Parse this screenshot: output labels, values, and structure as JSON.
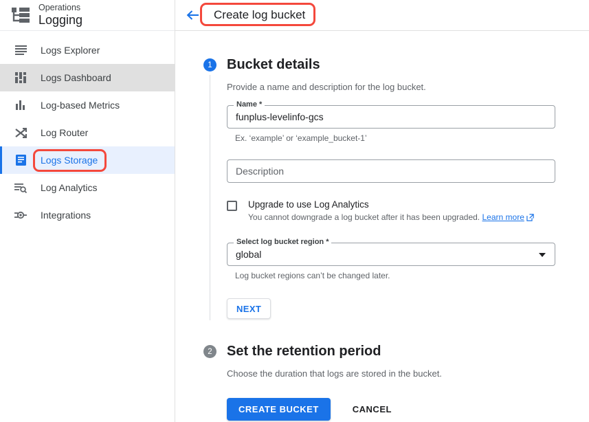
{
  "sidebar": {
    "brand": {
      "subtitle": "Operations",
      "title": "Logging",
      "logo_icon": "logging-hierarchy-icon"
    },
    "items": [
      {
        "label": "Logs Explorer",
        "icon": "list-lines-icon",
        "state": "default"
      },
      {
        "label": "Logs Dashboard",
        "icon": "dashboard-blocks-icon",
        "state": "hovered"
      },
      {
        "label": "Log-based Metrics",
        "icon": "bar-chart-icon",
        "state": "default"
      },
      {
        "label": "Log Router",
        "icon": "shuffle-arrows-icon",
        "state": "default"
      },
      {
        "label": "Logs Storage",
        "icon": "document-lines-icon",
        "state": "active"
      },
      {
        "label": "Log Analytics",
        "icon": "list-search-icon",
        "state": "default"
      },
      {
        "label": "Integrations",
        "icon": "integration-node-icon",
        "state": "default"
      }
    ]
  },
  "topbar": {
    "back_icon": "back-arrow-icon",
    "title": "Create log bucket"
  },
  "steps": [
    {
      "number": "1",
      "heading": "Bucket details",
      "description": "Provide a name and description for the log bucket."
    },
    {
      "number": "2",
      "heading": "Set the retention period",
      "description": "Choose the duration that logs are stored in the bucket."
    }
  ],
  "form": {
    "name_field": {
      "label": "Name *",
      "value": "funplus-levelinfo-gcs",
      "hint": "Ex. ‘example’ or ‘example_bucket-1’"
    },
    "description_field": {
      "placeholder": "Description"
    },
    "upgrade_checkbox": {
      "checked": false,
      "label": "Upgrade to use Log Analytics",
      "sub_text": "You cannot downgrade a log bucket after it has been upgraded.",
      "link_label": "Learn more",
      "link_icon": "external-link-icon"
    },
    "region_select": {
      "label": "Select log bucket region *",
      "value": "global",
      "hint": "Log bucket regions can’t be changed later.",
      "arrow_icon": "chevron-down-icon"
    },
    "next_button": "NEXT"
  },
  "actions": {
    "create_label": "CREATE BUCKET",
    "cancel_label": "CANCEL"
  },
  "colors": {
    "accent_blue": "#1a73e8",
    "active_bg": "#e8f0fe",
    "hover_bg": "#e0e0e0",
    "annotation_red": "#f4483c",
    "step2_badge": "#80868b"
  }
}
